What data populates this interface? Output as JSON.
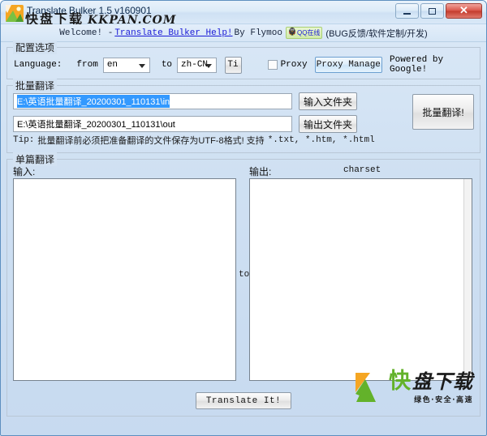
{
  "window": {
    "title": "Translate Bulker 1.5 v160901",
    "app_icon": "landscape-app-icon",
    "minimize_label": "",
    "maximize_label": "",
    "close_label": "✕"
  },
  "welcome": {
    "greeting": "Welcome! -",
    "help_link": "Translate Bulker Help!",
    "author": "By Flymoo",
    "qq_badge": "QQ在线",
    "note": "(BUG反馈/软件定制/开发)"
  },
  "config": {
    "group_title": "配置选项",
    "language_label": "Language:",
    "from_label": "from",
    "from_value": "en",
    "to_label": "to",
    "to_value": "zh-CN",
    "ti_button": "Ti",
    "proxy_checkbox_label": "Proxy",
    "proxy_checked": false,
    "proxy_manage_button": "Proxy Manage",
    "powered_by": "Powered by Google!"
  },
  "batch": {
    "group_title": "批量翻译",
    "input_path": "E:\\英语批量翻译_20200301_110131\\in",
    "input_path_selected": true,
    "output_path": "E:\\英语批量翻译_20200301_110131\\out",
    "input_folder_button": "输入文件夹",
    "output_folder_button": "输出文件夹",
    "run_button": "批量翻译!",
    "tip_prefix": "Tip:",
    "tip_text": "批量翻译前必须把准备翻译的文件保存为UTF-8格式! 支持",
    "tip_formats": "*.txt, *.htm, *.html"
  },
  "single": {
    "group_title": "单篇翻译",
    "input_label": "输入:",
    "output_label": "输出:",
    "charset_label": "charset",
    "separator_label": "to",
    "input_text": "",
    "output_text": "",
    "translate_button": "Translate It!"
  },
  "watermark": {
    "title_cn": "快盘下载",
    "title_en": "KKPAN.COM",
    "logo_kuai": "快",
    "logo_panxiazai": "盘下载",
    "logo_tagline": "绿色·安全·高速"
  },
  "colors": {
    "window_border": "#5d8fc0",
    "client_bg": "#d3e2f2",
    "selection_blue": "#3399ff",
    "link_blue": "#1a1ad6",
    "logo_green": "#63b22a",
    "logo_orange": "#f5a623",
    "close_red": "#c33a2c"
  }
}
